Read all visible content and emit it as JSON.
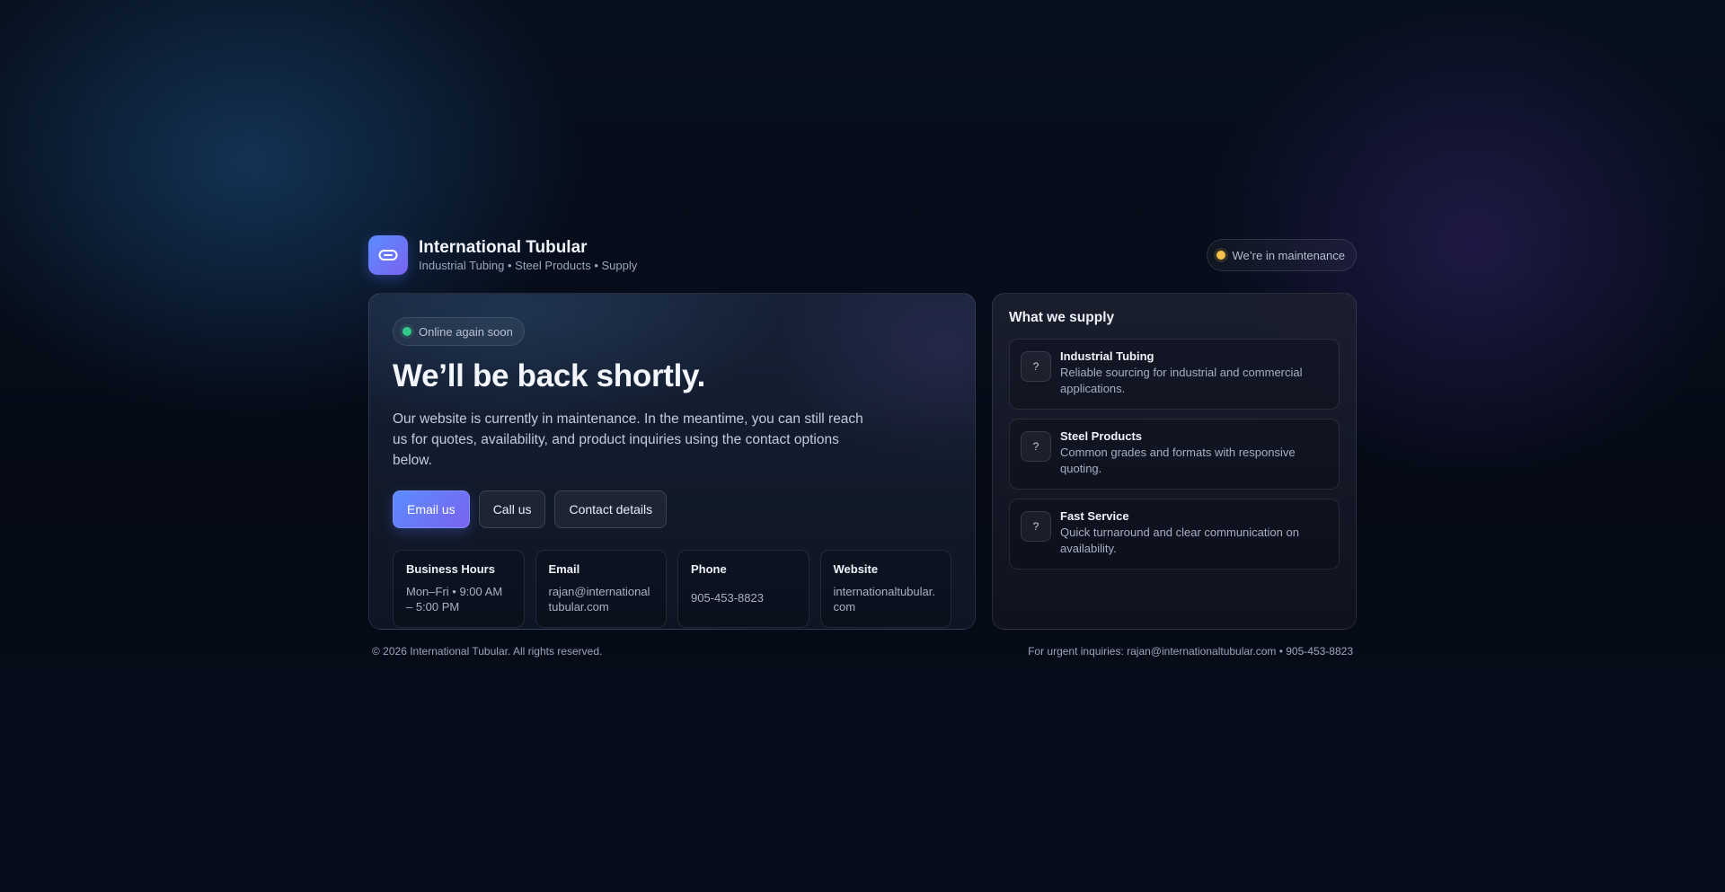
{
  "brand": {
    "name": "International Tubular",
    "tagline": "Industrial Tubing • Steel Products • Supply",
    "logo_icon": "link-chain-icon",
    "accent_start": "#5b8dff",
    "accent_end": "#7a62f0"
  },
  "maintenance_badge": {
    "label": "We’re in maintenance",
    "dot_color": "#f4c34a"
  },
  "main": {
    "status": {
      "label": "Online again soon",
      "dot_color": "#34c98a"
    },
    "headline": "We’ll be back shortly.",
    "description": "Our website is currently in maintenance. In the meantime, you can still reach us for quotes, availability, and product inquiries using the contact options below.",
    "buttons": {
      "email": "Email us",
      "call": "Call us",
      "contact": "Contact details"
    },
    "info": [
      {
        "title": "Business Hours",
        "value": "Mon–Fri • 9:00 AM – 5:00 PM"
      },
      {
        "title": "Email",
        "value": "rajan@internationaltubular.com"
      },
      {
        "title": "Phone",
        "value": "905-453-8823"
      },
      {
        "title": "Website",
        "value": "internationaltubular.com"
      }
    ]
  },
  "side": {
    "title": "What we supply",
    "items": [
      {
        "icon": "?",
        "name": "Industrial Tubing",
        "desc": "Reliable sourcing for industrial and commercial applications."
      },
      {
        "icon": "?",
        "name": "Steel Products",
        "desc": "Common grades and formats with responsive quoting."
      },
      {
        "icon": "?",
        "name": "Fast Service",
        "desc": "Quick turnaround and clear communication on availability."
      }
    ]
  },
  "footer": {
    "copyright": "© 2026 International Tubular. All rights reserved.",
    "urgent": "For urgent inquiries: rajan@internationaltubular.com • 905-453-8823"
  }
}
